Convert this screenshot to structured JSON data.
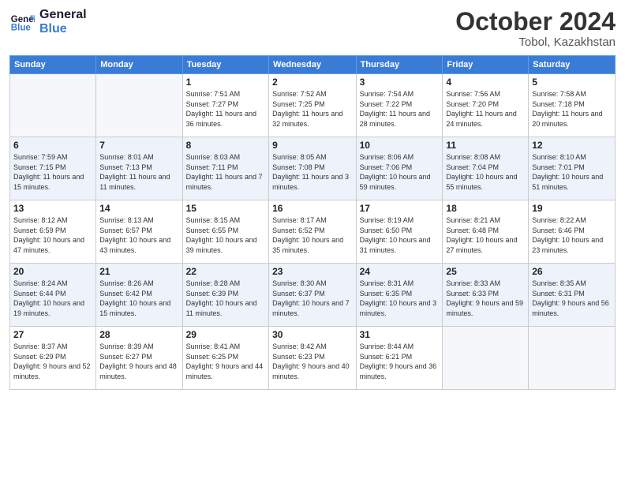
{
  "header": {
    "logo_line1": "General",
    "logo_line2": "Blue",
    "month_title": "October 2024",
    "location": "Tobol, Kazakhstan"
  },
  "days_of_week": [
    "Sunday",
    "Monday",
    "Tuesday",
    "Wednesday",
    "Thursday",
    "Friday",
    "Saturday"
  ],
  "weeks": [
    [
      {
        "day": "",
        "sunrise": "",
        "sunset": "",
        "daylight": ""
      },
      {
        "day": "",
        "sunrise": "",
        "sunset": "",
        "daylight": ""
      },
      {
        "day": "1",
        "sunrise": "Sunrise: 7:51 AM",
        "sunset": "Sunset: 7:27 PM",
        "daylight": "Daylight: 11 hours and 36 minutes."
      },
      {
        "day": "2",
        "sunrise": "Sunrise: 7:52 AM",
        "sunset": "Sunset: 7:25 PM",
        "daylight": "Daylight: 11 hours and 32 minutes."
      },
      {
        "day": "3",
        "sunrise": "Sunrise: 7:54 AM",
        "sunset": "Sunset: 7:22 PM",
        "daylight": "Daylight: 11 hours and 28 minutes."
      },
      {
        "day": "4",
        "sunrise": "Sunrise: 7:56 AM",
        "sunset": "Sunset: 7:20 PM",
        "daylight": "Daylight: 11 hours and 24 minutes."
      },
      {
        "day": "5",
        "sunrise": "Sunrise: 7:58 AM",
        "sunset": "Sunset: 7:18 PM",
        "daylight": "Daylight: 11 hours and 20 minutes."
      }
    ],
    [
      {
        "day": "6",
        "sunrise": "Sunrise: 7:59 AM",
        "sunset": "Sunset: 7:15 PM",
        "daylight": "Daylight: 11 hours and 15 minutes."
      },
      {
        "day": "7",
        "sunrise": "Sunrise: 8:01 AM",
        "sunset": "Sunset: 7:13 PM",
        "daylight": "Daylight: 11 hours and 11 minutes."
      },
      {
        "day": "8",
        "sunrise": "Sunrise: 8:03 AM",
        "sunset": "Sunset: 7:11 PM",
        "daylight": "Daylight: 11 hours and 7 minutes."
      },
      {
        "day": "9",
        "sunrise": "Sunrise: 8:05 AM",
        "sunset": "Sunset: 7:08 PM",
        "daylight": "Daylight: 11 hours and 3 minutes."
      },
      {
        "day": "10",
        "sunrise": "Sunrise: 8:06 AM",
        "sunset": "Sunset: 7:06 PM",
        "daylight": "Daylight: 10 hours and 59 minutes."
      },
      {
        "day": "11",
        "sunrise": "Sunrise: 8:08 AM",
        "sunset": "Sunset: 7:04 PM",
        "daylight": "Daylight: 10 hours and 55 minutes."
      },
      {
        "day": "12",
        "sunrise": "Sunrise: 8:10 AM",
        "sunset": "Sunset: 7:01 PM",
        "daylight": "Daylight: 10 hours and 51 minutes."
      }
    ],
    [
      {
        "day": "13",
        "sunrise": "Sunrise: 8:12 AM",
        "sunset": "Sunset: 6:59 PM",
        "daylight": "Daylight: 10 hours and 47 minutes."
      },
      {
        "day": "14",
        "sunrise": "Sunrise: 8:13 AM",
        "sunset": "Sunset: 6:57 PM",
        "daylight": "Daylight: 10 hours and 43 minutes."
      },
      {
        "day": "15",
        "sunrise": "Sunrise: 8:15 AM",
        "sunset": "Sunset: 6:55 PM",
        "daylight": "Daylight: 10 hours and 39 minutes."
      },
      {
        "day": "16",
        "sunrise": "Sunrise: 8:17 AM",
        "sunset": "Sunset: 6:52 PM",
        "daylight": "Daylight: 10 hours and 35 minutes."
      },
      {
        "day": "17",
        "sunrise": "Sunrise: 8:19 AM",
        "sunset": "Sunset: 6:50 PM",
        "daylight": "Daylight: 10 hours and 31 minutes."
      },
      {
        "day": "18",
        "sunrise": "Sunrise: 8:21 AM",
        "sunset": "Sunset: 6:48 PM",
        "daylight": "Daylight: 10 hours and 27 minutes."
      },
      {
        "day": "19",
        "sunrise": "Sunrise: 8:22 AM",
        "sunset": "Sunset: 6:46 PM",
        "daylight": "Daylight: 10 hours and 23 minutes."
      }
    ],
    [
      {
        "day": "20",
        "sunrise": "Sunrise: 8:24 AM",
        "sunset": "Sunset: 6:44 PM",
        "daylight": "Daylight: 10 hours and 19 minutes."
      },
      {
        "day": "21",
        "sunrise": "Sunrise: 8:26 AM",
        "sunset": "Sunset: 6:42 PM",
        "daylight": "Daylight: 10 hours and 15 minutes."
      },
      {
        "day": "22",
        "sunrise": "Sunrise: 8:28 AM",
        "sunset": "Sunset: 6:39 PM",
        "daylight": "Daylight: 10 hours and 11 minutes."
      },
      {
        "day": "23",
        "sunrise": "Sunrise: 8:30 AM",
        "sunset": "Sunset: 6:37 PM",
        "daylight": "Daylight: 10 hours and 7 minutes."
      },
      {
        "day": "24",
        "sunrise": "Sunrise: 8:31 AM",
        "sunset": "Sunset: 6:35 PM",
        "daylight": "Daylight: 10 hours and 3 minutes."
      },
      {
        "day": "25",
        "sunrise": "Sunrise: 8:33 AM",
        "sunset": "Sunset: 6:33 PM",
        "daylight": "Daylight: 9 hours and 59 minutes."
      },
      {
        "day": "26",
        "sunrise": "Sunrise: 8:35 AM",
        "sunset": "Sunset: 6:31 PM",
        "daylight": "Daylight: 9 hours and 56 minutes."
      }
    ],
    [
      {
        "day": "27",
        "sunrise": "Sunrise: 8:37 AM",
        "sunset": "Sunset: 6:29 PM",
        "daylight": "Daylight: 9 hours and 52 minutes."
      },
      {
        "day": "28",
        "sunrise": "Sunrise: 8:39 AM",
        "sunset": "Sunset: 6:27 PM",
        "daylight": "Daylight: 9 hours and 48 minutes."
      },
      {
        "day": "29",
        "sunrise": "Sunrise: 8:41 AM",
        "sunset": "Sunset: 6:25 PM",
        "daylight": "Daylight: 9 hours and 44 minutes."
      },
      {
        "day": "30",
        "sunrise": "Sunrise: 8:42 AM",
        "sunset": "Sunset: 6:23 PM",
        "daylight": "Daylight: 9 hours and 40 minutes."
      },
      {
        "day": "31",
        "sunrise": "Sunrise: 8:44 AM",
        "sunset": "Sunset: 6:21 PM",
        "daylight": "Daylight: 9 hours and 36 minutes."
      },
      {
        "day": "",
        "sunrise": "",
        "sunset": "",
        "daylight": ""
      },
      {
        "day": "",
        "sunrise": "",
        "sunset": "",
        "daylight": ""
      }
    ]
  ]
}
